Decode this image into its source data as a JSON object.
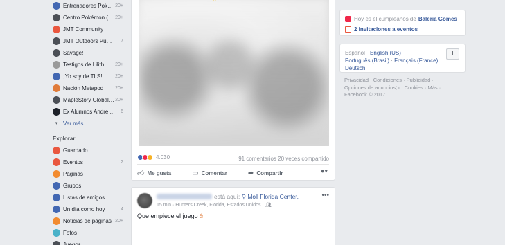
{
  "sidebar": {
    "items": [
      {
        "label": "Entrenadores Poké...",
        "count": "20+",
        "icon": "group-icon",
        "color": "#4267b2"
      },
      {
        "label": "Centro Pokémon (g...",
        "count": "20+",
        "icon": "gamepad-icon",
        "color": "#4b4f56"
      },
      {
        "label": "JMT Community",
        "count": "",
        "icon": "flag-icon",
        "color": "#e9573f"
      },
      {
        "label": "JMT Outdoors Publ...",
        "count": "7",
        "icon": "gamepad-icon",
        "color": "#4b4f56"
      },
      {
        "label": "Savage!",
        "count": "",
        "icon": "gamepad-icon",
        "color": "#4b4f56"
      },
      {
        "label": "Testigos de Lilith",
        "count": "20+",
        "icon": "skull-icon",
        "color": "#9a9a9a"
      },
      {
        "label": "¡Yo soy de TLS!",
        "count": "20+",
        "icon": "group-icon",
        "color": "#4267b2"
      },
      {
        "label": "Nación Metapod",
        "count": "20+",
        "icon": "metapod-icon",
        "color": "#e07b39"
      },
      {
        "label": "MapleStory Global ...",
        "count": "20+",
        "icon": "gamepad-icon",
        "color": "#4b4f56"
      },
      {
        "label": "Ex Alumnos Andre...",
        "count": "6",
        "icon": "graduation-cap-icon",
        "color": "#1d2129"
      }
    ],
    "more_label": "Ver más...",
    "explore_header": "Explorar",
    "explore": [
      {
        "label": "Guardado",
        "count": "",
        "icon": "bookmark-icon",
        "color": "#e9573f"
      },
      {
        "label": "Eventos",
        "count": "2",
        "icon": "calendar-icon",
        "color": "#e9573f"
      },
      {
        "label": "Páginas",
        "count": "",
        "icon": "flag-icon",
        "color": "#f28b30"
      },
      {
        "label": "Grupos",
        "count": "",
        "icon": "group-icon",
        "color": "#4267b2"
      },
      {
        "label": "Listas de amigos",
        "count": "",
        "icon": "friends-list-icon",
        "color": "#4267b2"
      },
      {
        "label": "Un día como hoy",
        "count": "4",
        "icon": "clock-icon",
        "color": "#4267b2"
      },
      {
        "label": "Noticias de páginas",
        "count": "20+",
        "icon": "news-icon",
        "color": "#f28b30"
      },
      {
        "label": "Fotos",
        "count": "",
        "icon": "photo-icon",
        "color": "#4ab2c9"
      },
      {
        "label": "Juegos",
        "count": "",
        "icon": "games-icon",
        "color": "#4b4f56"
      }
    ]
  },
  "post1": {
    "reaction_count": "4.030",
    "comments": "91 comentarios",
    "shares": "20 veces compartido",
    "actions": {
      "like": "Me gusta",
      "comment": "Comentar",
      "share": "Compartir"
    }
  },
  "post2": {
    "at_prefix": "está aquí:",
    "location": "Moll Florida Center.",
    "meta": "15 min · Hunters Creek, Florida, Estados Unidos ·",
    "text": "Que empiece el juego"
  },
  "right": {
    "birthday_prefix": "Hoy es el cumpleaños de",
    "birthday_name": "Baleria Gomes",
    "invitations": "2 invitaciones a eventos",
    "languages": {
      "current": "Español",
      "links": [
        "English (US)",
        "Português (Brasil)",
        "Français (France)",
        "Deutsch"
      ]
    },
    "footer": [
      "Privacidad",
      "Condiciones",
      "Publicidad",
      "Opciones de anuncios",
      "Cookies",
      "Más",
      "Facebook © 2017"
    ]
  }
}
